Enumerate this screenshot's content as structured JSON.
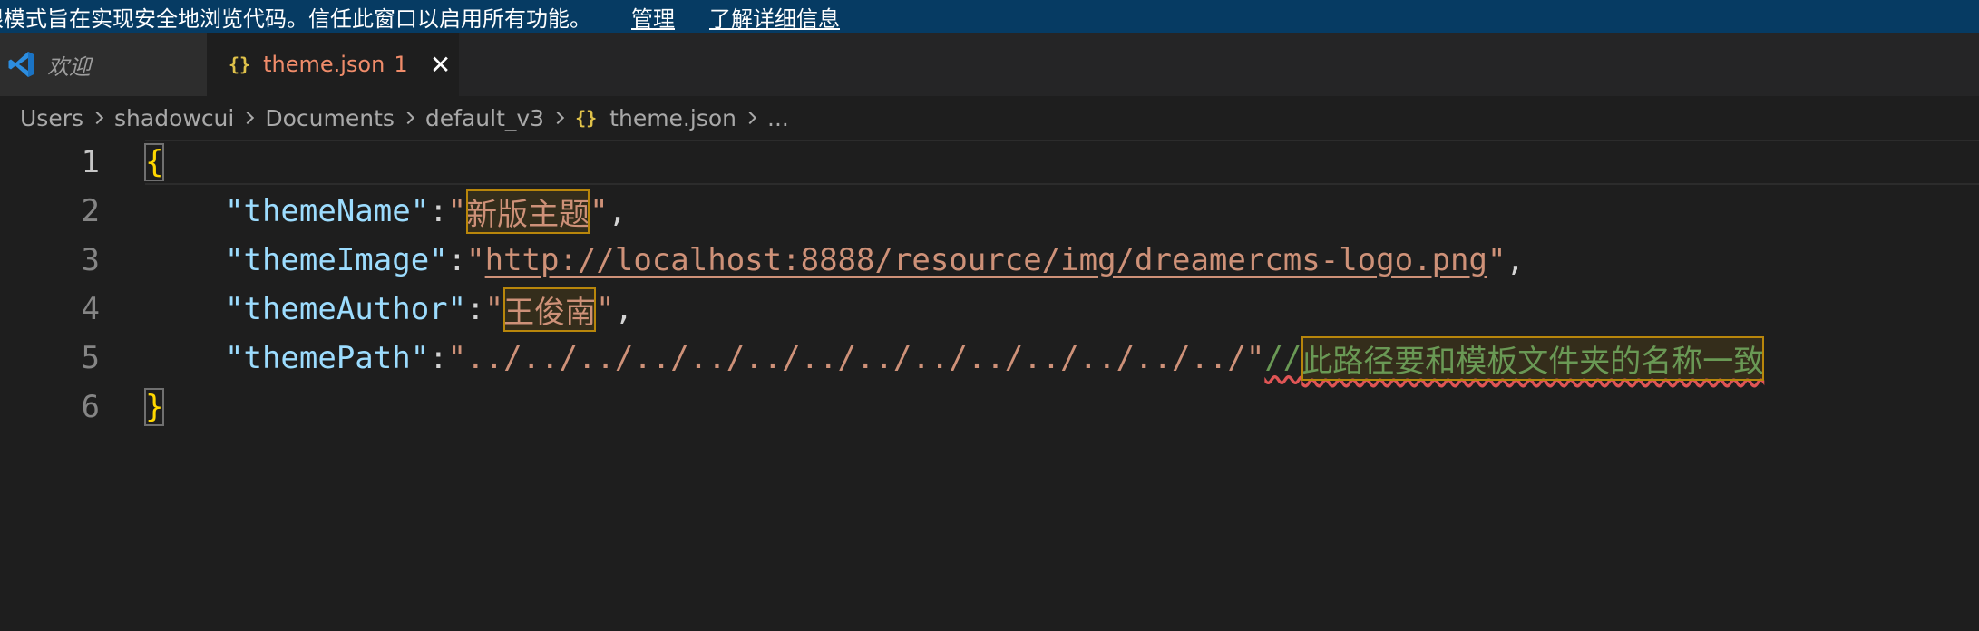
{
  "banner": {
    "message": "限模式旨在实现安全地浏览代码。信任此窗口以启用所有功能。",
    "manage_label": "管理",
    "learn_more_label": "了解详细信息"
  },
  "tabs": [
    {
      "label": "欢迎",
      "icon": "vscode-logo-icon"
    },
    {
      "label": "theme.json",
      "icon": "json-file-icon",
      "problem_count": "1"
    }
  ],
  "breadcrumb": {
    "items": [
      "Users",
      "shadowcui",
      "Documents",
      "default_v3",
      "theme.json",
      "..."
    ]
  },
  "editor": {
    "line_numbers": [
      "1",
      "2",
      "3",
      "4",
      "5",
      "6"
    ],
    "open_brace": "{",
    "close_brace": "}",
    "lines": [
      {
        "key": "\"themeName\"",
        "colon": ":",
        "q1": "\"",
        "value": "新版主题",
        "q2": "\"",
        "comma": ","
      },
      {
        "key": "\"themeImage\"",
        "colon": ":",
        "q1": "\"",
        "value": "http://localhost:8888/resource/img/dreamercms-logo.png",
        "q2": "\"",
        "comma": ","
      },
      {
        "key": "\"themeAuthor\"",
        "colon": ":",
        "q1": "\"",
        "value": "王俊南",
        "q2": "\"",
        "comma": ","
      },
      {
        "key": "\"themePath\"",
        "colon": ":",
        "value": "\"../../../../../../../../../../../../../../\"",
        "comment_slashes": "//",
        "comment_text": "此路径要和模板文件夹的名称一致"
      }
    ]
  },
  "colors": {
    "banner_bg": "#063b63",
    "key": "#9cdcfe",
    "string": "#ce9178",
    "comment": "#6a9955",
    "brace": "#ffd700",
    "active_tab_text": "#f08c6a"
  }
}
